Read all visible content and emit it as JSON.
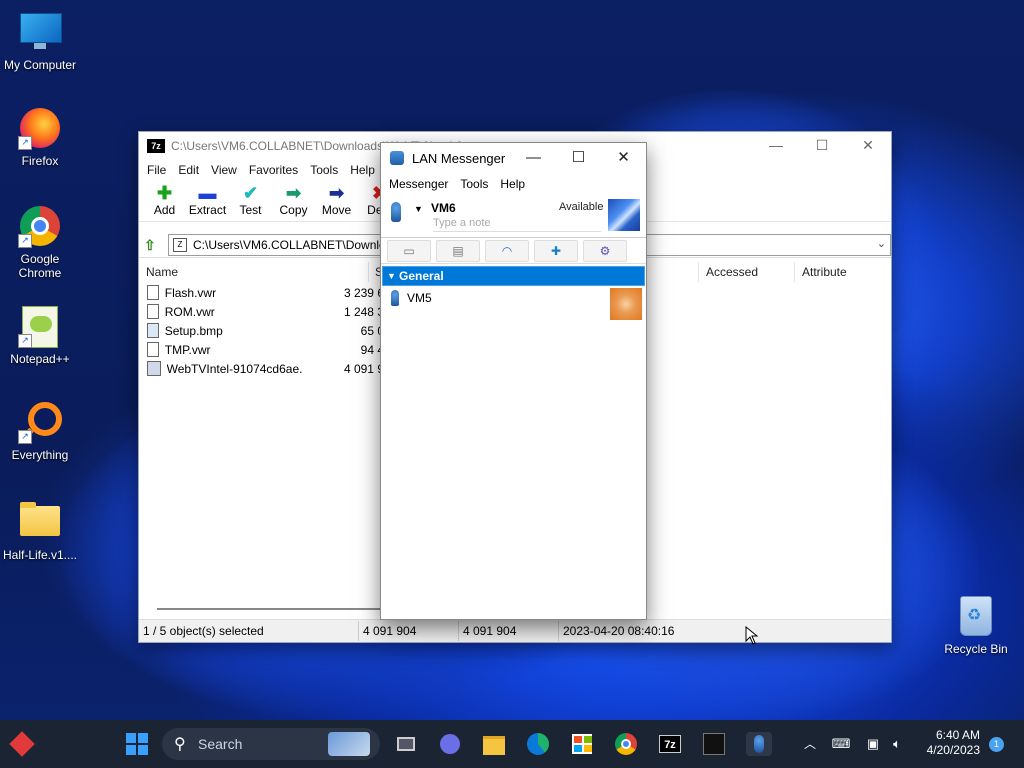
{
  "desktop": {
    "icons": [
      {
        "label": "My Computer"
      },
      {
        "label": "Firefox"
      },
      {
        "label": "Google Chrome"
      },
      {
        "label": "Notepad++"
      },
      {
        "label": "Everything"
      },
      {
        "label": "Half-Life.v1...."
      }
    ],
    "recycle_bin": "Recycle Bin"
  },
  "zip": {
    "title": "C:\\Users\\VM6.COLLABNET\\Downloads\\WebTV\\Intel-9",
    "menu": [
      "File",
      "Edit",
      "View",
      "Favorites",
      "Tools",
      "Help"
    ],
    "toolbar": [
      "Add",
      "Extract",
      "Test",
      "Copy",
      "Move",
      "Dele"
    ],
    "address": "C:\\Users\\VM6.COLLABNET\\Downlo",
    "columns": [
      "Name",
      "S",
      "Accessed",
      "Attribute"
    ],
    "files": [
      {
        "name": "Flash.vwr",
        "size": "3 239 6"
      },
      {
        "name": "ROM.vwr",
        "size": "1 248 3"
      },
      {
        "name": "Setup.bmp",
        "size": "65 0"
      },
      {
        "name": "TMP.vwr",
        "size": "94 4"
      },
      {
        "name": "WebTVIntel-91074cd6ae...",
        "size": "4 091 9"
      }
    ],
    "status": {
      "selected": "1 / 5 object(s) selected",
      "size1": "4 091 904",
      "size2": "4 091 904",
      "date": "2023-04-20 08:40:16"
    }
  },
  "lan": {
    "title": "LAN Messenger",
    "menu": [
      "Messenger",
      "Tools",
      "Help"
    ],
    "user": "VM6",
    "status": "Available",
    "note_placeholder": "Type a note",
    "group": "General",
    "contacts": [
      {
        "name": "VM5"
      }
    ]
  },
  "taskbar": {
    "search": "Search",
    "time": "6:40 AM",
    "date": "4/20/2023",
    "notifications": "1"
  },
  "colors": {
    "accent": "#0078d7",
    "taskbar": "#1b2433"
  }
}
